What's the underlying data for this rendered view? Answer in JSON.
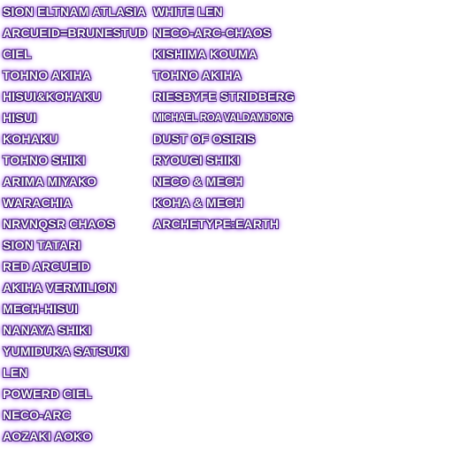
{
  "characters": {
    "left": [
      "SION ELTNAM ATLASIA",
      "ARCUEID=BRUNESTUD",
      "CIEL",
      "TOHNO AKIHA",
      "HISUI&KOHAKU",
      "HISUI",
      "KOHAKU",
      "TOHNO SHIKI",
      "ARIMA MIYAKO",
      "WARACHIA",
      "NRVNQSR CHAOS",
      "SION TATARI",
      "RED ARCUEID",
      "AKIHA VERMILION",
      "MECH-HISUI",
      "NANAYA SHIKI",
      "YUMIDUKA SATSUKI",
      "LEN",
      "POWERD CIEL",
      "NECO-ARC",
      "AOZAKI AOKO"
    ],
    "right": [
      "WHITE LEN",
      "NECO-ARC-CHAOS",
      "KISHIMA KOUMA",
      "TOHNO AKIHA",
      "RIESBYFE STRIDBERG",
      "MICHAEL ROA VALDAMJONG",
      "DUST OF OSIRIS",
      "RYOUGI SHIKI",
      "NECO & MECH",
      "KOHA & MECH",
      "ARCHETYPE:EARTH"
    ]
  },
  "colors": {
    "text": "#ffffff",
    "glow": "#9b30ff",
    "outline": "#3a1a6a",
    "background": "#ffffff"
  }
}
